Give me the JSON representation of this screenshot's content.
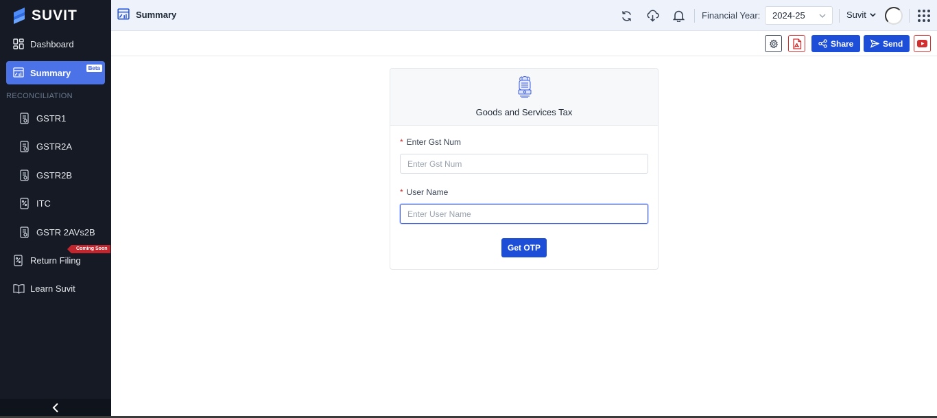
{
  "app": {
    "brand": "SUVIT",
    "accent": "#1d4ed8",
    "sidebar_bg": "#151a24"
  },
  "sidebar": {
    "items": [
      {
        "label": "Dashboard",
        "icon": "dashboard-grid-icon"
      },
      {
        "label": "Summary",
        "icon": "summary-chart-icon",
        "badge": "Beta",
        "active": true
      }
    ],
    "section_label": "RECONCILIATION",
    "reconciliation_items": [
      {
        "label": "GSTR1",
        "icon": "document-icon"
      },
      {
        "label": "GSTR2A",
        "icon": "document-icon"
      },
      {
        "label": "GSTR2B",
        "icon": "document-icon"
      },
      {
        "label": "ITC",
        "icon": "tax-document-icon"
      },
      {
        "label": "GSTR 2AVs2B",
        "icon": "document-icon"
      }
    ],
    "more_items": [
      {
        "label": "Return Filing",
        "icon": "tax-document-icon",
        "ribbon": "Coming Soon"
      },
      {
        "label": "Learn Suvit",
        "icon": "book-icon"
      }
    ],
    "collapse_icon": "chevron-left-icon"
  },
  "header": {
    "title": "Summary",
    "icons": [
      "refresh-icon",
      "cloud-download-icon",
      "bell-icon"
    ],
    "financial_year_label": "Financial Year:",
    "financial_year_value": "2024-25",
    "user_name": "Suvit"
  },
  "toolbar": {
    "share_label": "Share",
    "send_label": "Send",
    "icons": [
      "settings-gear-icon",
      "pdf-icon",
      "share-icon",
      "send-icon",
      "youtube-icon"
    ]
  },
  "gst_card": {
    "title": "Goods and Services Tax",
    "emblem": "national-emblem-icon",
    "gst_num_label": "Enter Gst Num",
    "gst_num_placeholder": "Enter Gst Num",
    "user_name_label": "User Name",
    "user_name_placeholder": "Enter User Name",
    "required_mark": "*",
    "submit_label": "Get OTP"
  }
}
